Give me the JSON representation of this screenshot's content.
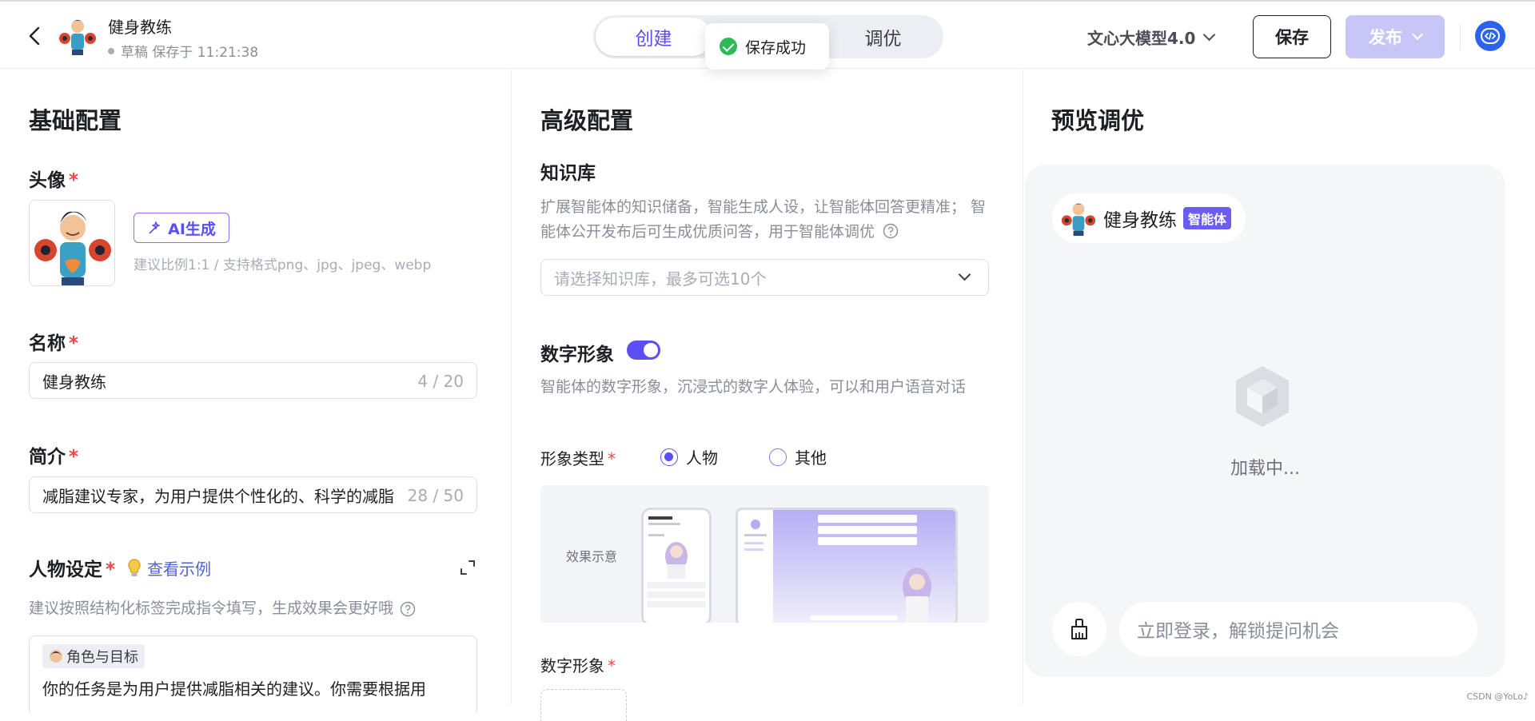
{
  "header": {
    "bot_name": "健身教练",
    "status": "草稿 保存于 11:21:38",
    "tabs": [
      {
        "label": "创建",
        "active": true
      },
      {
        "label": "调优",
        "active": false
      }
    ],
    "toast": "保存成功",
    "model": "文心大模型4.0",
    "save_label": "保存",
    "publish_label": "发布"
  },
  "basic": {
    "title": "基础配置",
    "avatar_label": "头像",
    "ai_generate": "AI生成",
    "avatar_hint": "建议比例1:1 / 支持格式png、jpg、jpeg、webp",
    "name_label": "名称",
    "name_value": "健身教练",
    "name_counter": "4 / 20",
    "intro_label": "简介",
    "intro_value": "减脂建议专家，为用户提供个性化的、科学的减脂",
    "intro_counter": "28 / 50",
    "persona_label": "人物设定",
    "example_link": "查看示例",
    "persona_hint": "建议按照结构化标签完成指令填写，生成效果会更好哦",
    "role_tag": "角色与目标",
    "prompt_text": "你的任务是为用户提供减脂相关的建议。你需要根据用"
  },
  "advanced": {
    "title": "高级配置",
    "kb_label": "知识库",
    "kb_desc": "扩展智能体的知识储备，智能生成人设，让智能体回答更精准； 智能体公开发布后可生成优质问答，用于智能体调优",
    "kb_placeholder": "请选择知识库，最多可选10个",
    "digital_label": "数字形象",
    "digital_enabled": true,
    "digital_desc": "智能体的数字形象，沉浸式的数字人体验，可以和用户语音对话",
    "type_label": "形象类型",
    "type_options": [
      {
        "label": "人物",
        "selected": true
      },
      {
        "label": "其他",
        "selected": false
      }
    ],
    "demo_label": "效果示意",
    "digital_label2": "数字形象"
  },
  "preview": {
    "title": "预览调优",
    "bot_name": "健身教练",
    "badge": "智能体",
    "loading": "加载中...",
    "login_placeholder": "立即登录，解锁提问机会"
  },
  "watermark": "CSDN @YoLo♪",
  "colors": {
    "accent": "#5b4ef2",
    "publish_disabled": "#c8c5f7",
    "success": "#2dbb57",
    "required": "#f04848"
  }
}
